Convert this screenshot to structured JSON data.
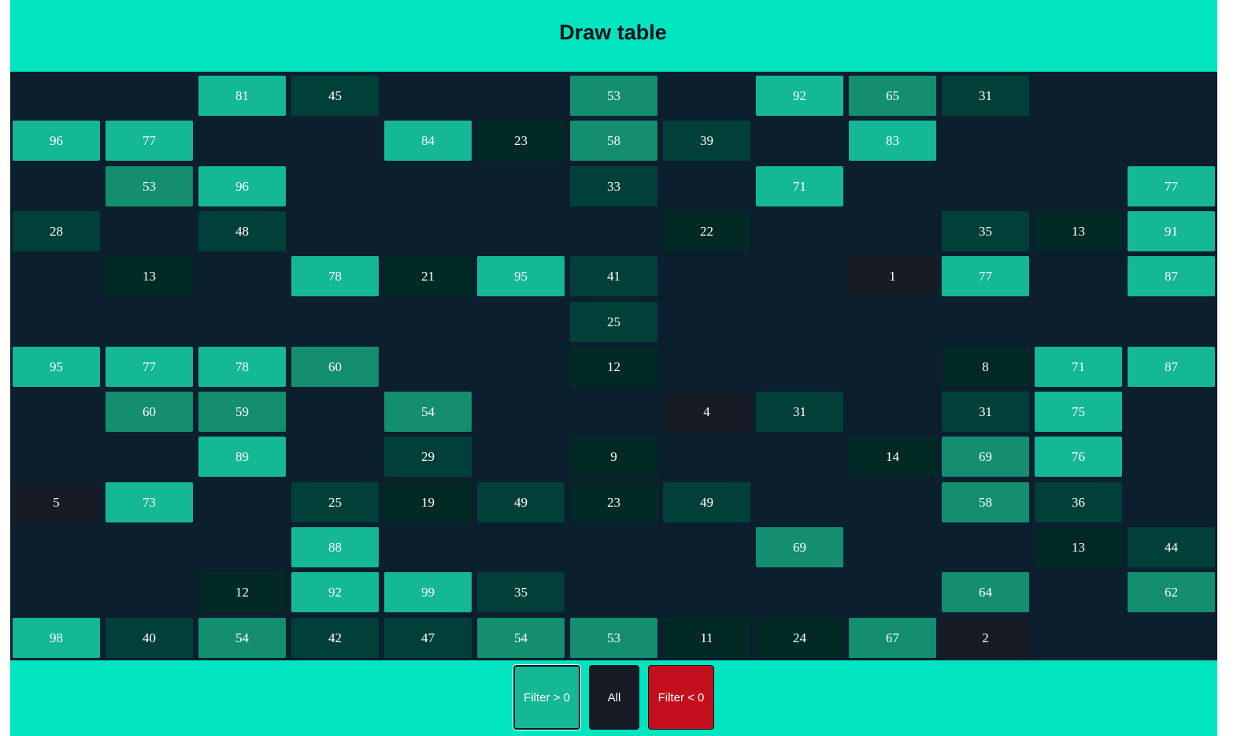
{
  "header": {
    "title": "Draw table"
  },
  "colors": {
    "header_bg": "#00e5c0",
    "board_bg": "#0b1f2e",
    "cell_very_low": "#161b25",
    "cell_low": "#022a24",
    "cell_mid": "#014038",
    "cell_high": "#138e6e",
    "cell_top": "#14b894",
    "button_filter_pos": "#14b894",
    "button_all": "#161b25",
    "button_filter_neg": "#c30f1d"
  },
  "table": {
    "columns": 13,
    "rows": 13,
    "cells": [
      [
        null,
        null,
        81,
        45,
        null,
        null,
        53,
        null,
        92,
        65,
        31,
        null,
        null
      ],
      [
        96,
        77,
        null,
        null,
        84,
        23,
        58,
        39,
        null,
        83,
        null,
        null,
        null
      ],
      [
        null,
        53,
        96,
        null,
        null,
        null,
        33,
        null,
        71,
        null,
        null,
        null,
        77
      ],
      [
        28,
        null,
        48,
        null,
        null,
        null,
        null,
        22,
        null,
        null,
        35,
        13,
        91
      ],
      [
        null,
        13,
        null,
        78,
        21,
        95,
        41,
        null,
        null,
        1,
        77,
        null,
        87
      ],
      [
        null,
        null,
        null,
        null,
        null,
        null,
        25,
        null,
        null,
        null,
        null,
        null,
        null
      ],
      [
        95,
        77,
        78,
        60,
        null,
        null,
        12,
        null,
        null,
        null,
        8,
        71,
        87
      ],
      [
        null,
        60,
        59,
        null,
        54,
        null,
        null,
        4,
        31,
        null,
        31,
        75,
        null
      ],
      [
        null,
        null,
        89,
        null,
        29,
        null,
        9,
        null,
        null,
        14,
        69,
        76,
        null
      ],
      [
        5,
        73,
        null,
        25,
        19,
        49,
        23,
        49,
        null,
        null,
        58,
        36,
        null
      ],
      [
        null,
        null,
        null,
        88,
        null,
        null,
        null,
        null,
        69,
        null,
        null,
        13,
        44
      ],
      [
        null,
        null,
        12,
        92,
        99,
        35,
        null,
        null,
        null,
        null,
        64,
        null,
        62
      ],
      [
        98,
        40,
        54,
        42,
        47,
        54,
        53,
        11,
        24,
        67,
        2,
        null,
        null
      ]
    ]
  },
  "footer": {
    "buttons": {
      "filter_positive": "Filter > 0",
      "all": "All",
      "filter_negative": "Filter < 0"
    }
  }
}
